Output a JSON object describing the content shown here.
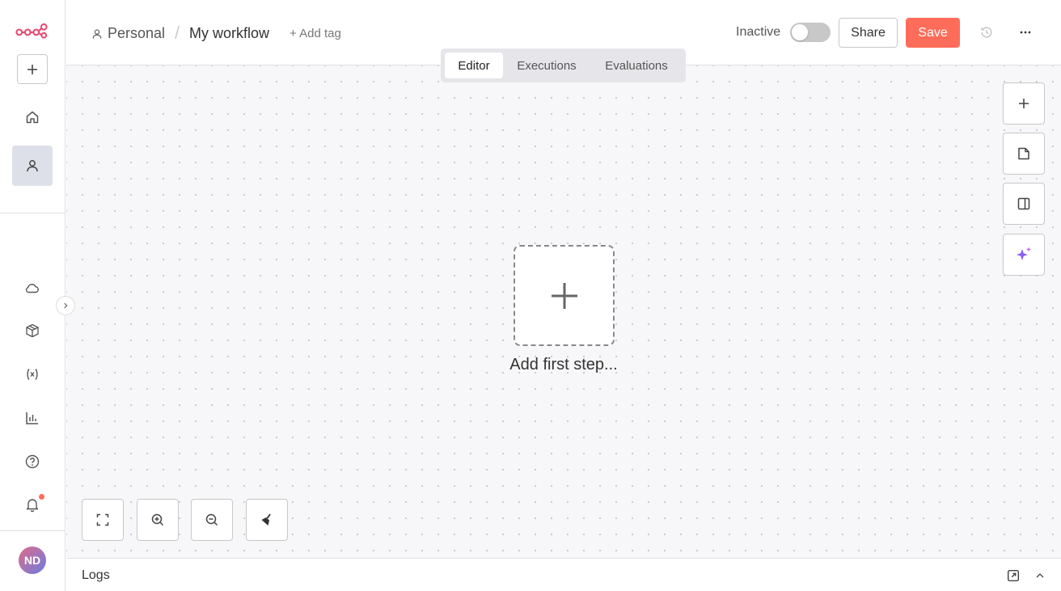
{
  "app": {
    "logo_icon": "n8n-logo-icon",
    "brand_color": "#ea4b71",
    "accent_color": "#ff6d5a"
  },
  "sidebar": {
    "new_button_icon": "plus-icon",
    "nav_top": [
      "home-icon",
      "user-icon"
    ],
    "nav_bottom": [
      "cloud-icon",
      "templates-icon",
      "variables-icon",
      "insights-icon",
      "help-icon",
      "bell-icon"
    ],
    "avatar_initials": "ND"
  },
  "header": {
    "breadcrumb_project": "Personal",
    "breadcrumb_sep": "/",
    "workflow_name": "My workflow",
    "add_tag": "+ Add tag",
    "status_label": "Inactive",
    "share_label": "Share",
    "save_label": "Save"
  },
  "tabs": {
    "items": [
      "Editor",
      "Executions",
      "Evaluations"
    ],
    "active": "Editor"
  },
  "canvas": {
    "first_step_label": "Add first step..."
  },
  "logs": {
    "label": "Logs"
  }
}
